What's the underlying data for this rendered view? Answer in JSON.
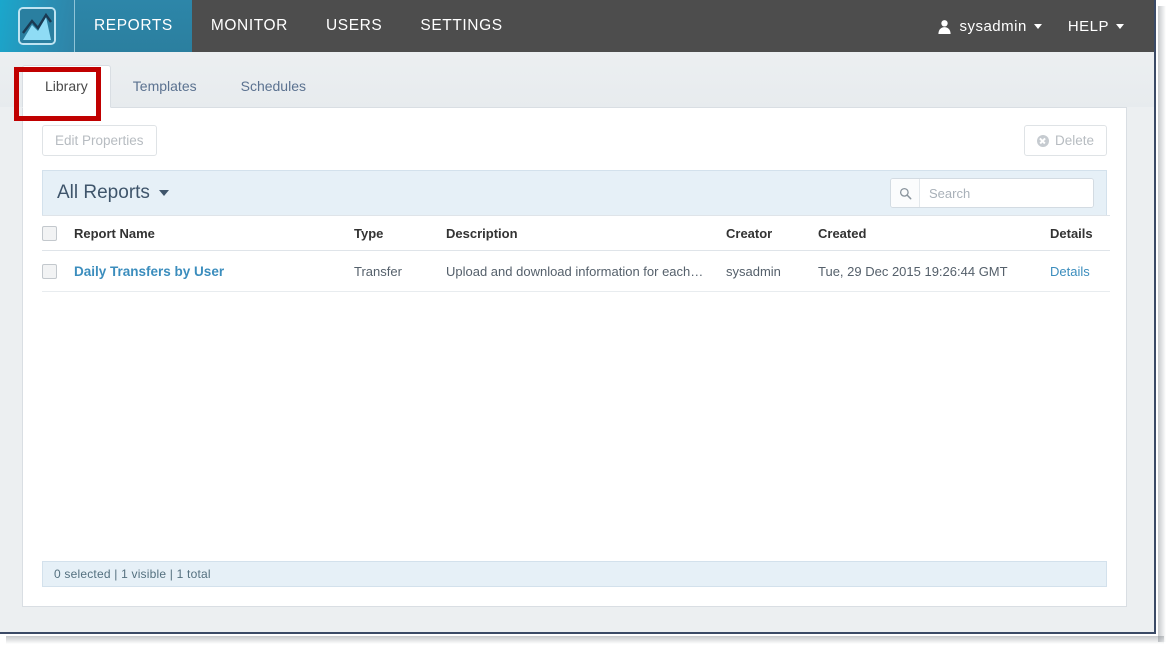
{
  "topnav": {
    "logo_icon": "chart-logo-icon",
    "items": [
      {
        "label": "REPORTS",
        "active": true
      },
      {
        "label": "MONITOR",
        "active": false
      },
      {
        "label": "USERS",
        "active": false
      },
      {
        "label": "SETTINGS",
        "active": false
      }
    ],
    "user": {
      "icon": "user-icon",
      "label": "sysadmin"
    },
    "help": {
      "label": "HELP"
    },
    "colors": {
      "bar": "#4d4d4d",
      "active_tab": "#2b7f9f",
      "logo": "#1aa7cc"
    }
  },
  "tabs": [
    {
      "label": "Library",
      "active": true
    },
    {
      "label": "Templates",
      "active": false
    },
    {
      "label": "Schedules",
      "active": false
    }
  ],
  "annotation": {
    "color": "#c00000",
    "target": "Library"
  },
  "toolbar": {
    "edit_properties_label": "Edit Properties",
    "delete_label": "Delete",
    "delete_icon": "circle-x-icon"
  },
  "filter_bar": {
    "dropdown_label": "All Reports",
    "dropdown_icon": "caret-down-icon",
    "search": {
      "icon": "search-icon",
      "value": "",
      "placeholder": "Search"
    }
  },
  "table": {
    "columns": [
      "Report Name",
      "Type",
      "Description",
      "Creator",
      "Created",
      "Details"
    ],
    "rows": [
      {
        "name": "Daily Transfers by User",
        "type": "Transfer",
        "description": "Upload and download information for each…",
        "creator": "sysadmin",
        "created": "Tue, 29 Dec 2015 19:26:44 GMT",
        "details_label": "Details"
      }
    ]
  },
  "status_bar": {
    "text": "0 selected | 1 visible | 1 total"
  }
}
